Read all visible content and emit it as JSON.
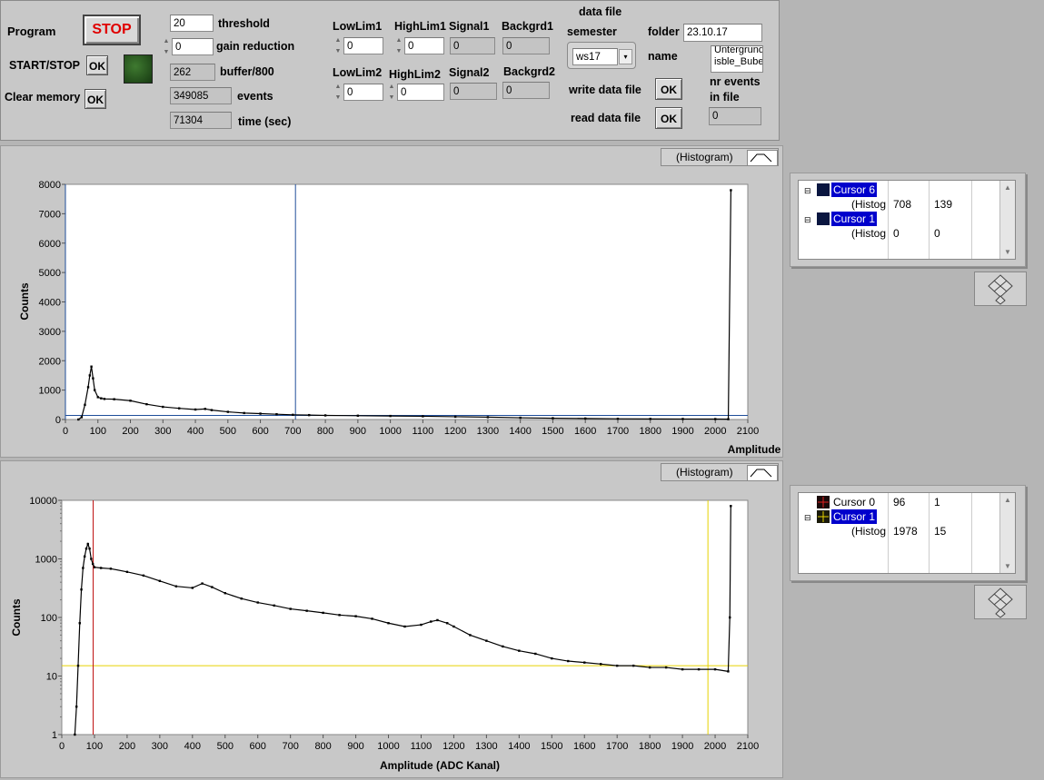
{
  "controls": {
    "program_label": "Program",
    "stop_label": "STOP",
    "startstop_label": "START/STOP",
    "clear_label": "Clear memory",
    "ok_label": "OK",
    "threshold_value": "20",
    "threshold_label": "threshold",
    "gain_value": "0",
    "gain_label": "gain reduction",
    "buffer_value": "262",
    "buffer_label": "buffer/800",
    "events_value": "349085",
    "events_label": "events",
    "time_value": "71304",
    "time_label": "time (sec)"
  },
  "limits": {
    "lowlim1_label": "LowLim1",
    "lowlim1_value": "0",
    "highlim1_label": "HighLim1",
    "highlim1_value": "0",
    "signal1_label": "Signal1",
    "signal1_value": "0",
    "backgrd1_label": "Backgrd1",
    "backgrd1_value": "0",
    "lowlim2_label": "LowLim2",
    "lowlim2_value": "0",
    "highlim2_label": "HighLim2",
    "highlim2_value": "0",
    "signal2_label": "Signal2",
    "signal2_value": "0",
    "backgrd2_label": "Backgrd2",
    "backgrd2_value": "0"
  },
  "datafile": {
    "title": "data file",
    "semester_label": "semester",
    "semester_value": "ws17",
    "folder_label": "folder",
    "folder_value": "23.10.17",
    "name_label": "name",
    "name_line1": "Untergrund_N",
    "name_line2": "isble_Bubeck",
    "write_label": "write data file",
    "read_label": "read data file",
    "nrevents_label_1": "nr events",
    "nrevents_label_2": "in file",
    "nrevents_value": "0"
  },
  "graph1": {
    "legend": "(Histogram)",
    "cursors": [
      {
        "name": "Cursor 6",
        "selected": true,
        "x": "708",
        "y": "139",
        "color": "#1f3b8a"
      },
      {
        "name": "(Histog",
        "x": "",
        "y": ""
      },
      {
        "name": "Cursor 1",
        "selected": true,
        "x": "0",
        "y": "0",
        "color": "#1f3b8a"
      },
      {
        "name": "(Histog",
        "x": "",
        "y": ""
      }
    ]
  },
  "graph2": {
    "legend": "(Histogram)",
    "cursors": [
      {
        "name": "Cursor 0",
        "x": "96",
        "y": "1",
        "color": "#c00000"
      },
      {
        "name": "Cursor 1",
        "selected": true,
        "x": "",
        "y": "",
        "color": "#e6d200"
      },
      {
        "name": "(Histog",
        "x": "1978",
        "y": "15"
      }
    ]
  },
  "chart_data": [
    {
      "type": "scatter",
      "title": "",
      "xlabel": "Amplitude",
      "ylabel": "Counts",
      "xlim": [
        0,
        2100
      ],
      "ylim": [
        0,
        8000
      ],
      "xticks": [
        0,
        100,
        200,
        300,
        400,
        500,
        600,
        700,
        800,
        900,
        1000,
        1100,
        1200,
        1300,
        1400,
        1500,
        1600,
        1700,
        1800,
        1900,
        2000,
        2100
      ],
      "yticks": [
        0,
        1000,
        2000,
        3000,
        4000,
        5000,
        6000,
        7000,
        8000
      ],
      "grid": false,
      "cursor_x": [
        0,
        708
      ],
      "cursor_y": [
        139
      ],
      "series": [
        {
          "x": [
            40,
            50,
            60,
            70,
            75,
            80,
            85,
            90,
            100,
            110,
            120,
            150,
            200,
            250,
            300,
            350,
            400,
            430,
            450,
            500,
            550,
            600,
            650,
            700,
            750,
            800,
            900,
            1000,
            1100,
            1200,
            1300,
            1400,
            1500,
            1600,
            1700,
            1800,
            1900,
            2000,
            2040,
            2048
          ],
          "values": [
            1,
            80,
            500,
            1100,
            1500,
            1800,
            1400,
            1000,
            760,
            720,
            700,
            690,
            640,
            520,
            430,
            380,
            340,
            360,
            320,
            260,
            220,
            200,
            180,
            160,
            150,
            140,
            130,
            120,
            110,
            95,
            80,
            60,
            45,
            35,
            25,
            20,
            18,
            15,
            12,
            7800
          ]
        }
      ]
    },
    {
      "type": "scatter",
      "title": "",
      "xlabel": "Amplitude (ADC Kanal)",
      "ylabel": "Counts",
      "yscale": "log",
      "xlim": [
        0,
        2100
      ],
      "ylim": [
        1,
        10000
      ],
      "xticks": [
        0,
        100,
        200,
        300,
        400,
        500,
        600,
        700,
        800,
        900,
        1000,
        1100,
        1200,
        1300,
        1400,
        1500,
        1600,
        1700,
        1800,
        1900,
        2000,
        2100
      ],
      "yticks": [
        1,
        10,
        100,
        1000,
        10000
      ],
      "grid": false,
      "cursor_x": [
        96,
        1978
      ],
      "cursor_y": [
        15
      ],
      "series": [
        {
          "x": [
            40,
            45,
            50,
            55,
            60,
            65,
            70,
            75,
            80,
            85,
            90,
            95,
            100,
            120,
            150,
            200,
            250,
            300,
            350,
            400,
            430,
            460,
            500,
            550,
            600,
            650,
            700,
            750,
            800,
            850,
            900,
            950,
            1000,
            1050,
            1100,
            1130,
            1150,
            1180,
            1200,
            1250,
            1300,
            1350,
            1400,
            1450,
            1500,
            1550,
            1600,
            1650,
            1700,
            1750,
            1800,
            1850,
            1900,
            1950,
            2000,
            2040,
            2045,
            2048
          ],
          "values": [
            1,
            3,
            15,
            80,
            300,
            700,
            1100,
            1500,
            1800,
            1500,
            1000,
            820,
            720,
            700,
            680,
            600,
            520,
            420,
            340,
            320,
            380,
            330,
            260,
            210,
            180,
            160,
            140,
            130,
            120,
            110,
            105,
            95,
            80,
            70,
            75,
            85,
            90,
            80,
            70,
            50,
            40,
            32,
            27,
            24,
            20,
            18,
            17,
            16,
            15,
            15,
            14,
            14,
            13,
            13,
            13,
            12,
            100,
            8000
          ]
        }
      ]
    }
  ]
}
